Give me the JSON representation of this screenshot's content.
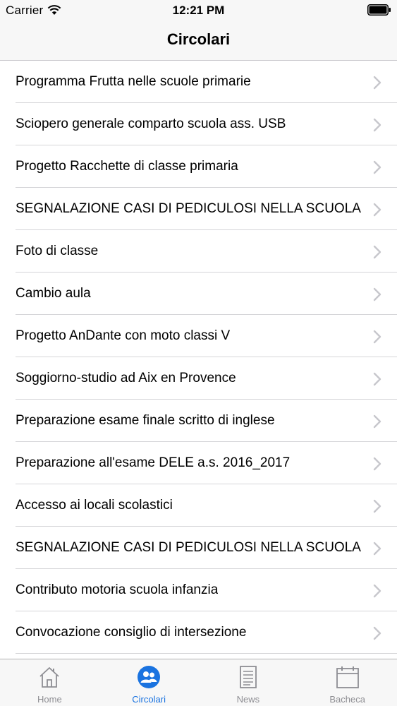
{
  "status_bar": {
    "carrier": "Carrier",
    "time": "12:21 PM"
  },
  "nav": {
    "title": "Circolari"
  },
  "list": {
    "items": [
      {
        "label": "Programma Frutta nelle scuole primarie"
      },
      {
        "label": "Sciopero generale comparto scuola ass. USB"
      },
      {
        "label": "Progetto Racchette di classe primaria"
      },
      {
        "label": "SEGNALAZIONE CASI DI PEDICULOSI NELLA SCUOLA"
      },
      {
        "label": "Foto di classe"
      },
      {
        "label": "Cambio aula"
      },
      {
        "label": "Progetto AnDante con moto classi V"
      },
      {
        "label": "Soggiorno-studio ad Aix en Provence"
      },
      {
        "label": "Preparazione esame finale scritto di inglese"
      },
      {
        "label": "Preparazione all'esame DELE a.s. 2016_2017"
      },
      {
        "label": "Accesso ai locali scolastici"
      },
      {
        "label": "SEGNALAZIONE CASI DI PEDICULOSI NELLA SCUOLA"
      },
      {
        "label": "Contributo motoria scuola infanzia"
      },
      {
        "label": "Convocazione consiglio di intersezione"
      }
    ]
  },
  "tabbar": {
    "tabs": [
      {
        "label": "Home",
        "icon": "home-icon",
        "active": false
      },
      {
        "label": "Circolari",
        "icon": "people-icon",
        "active": true
      },
      {
        "label": "News",
        "icon": "newspaper-icon",
        "active": false
      },
      {
        "label": "Bacheca",
        "icon": "calendar-icon",
        "active": false
      }
    ]
  },
  "colors": {
    "accent": "#1a73e0",
    "inactive": "#8e8e93",
    "bar_background": "#f7f7f7",
    "separator": "#d5d5d8",
    "chevron": "#c7c7cc"
  }
}
